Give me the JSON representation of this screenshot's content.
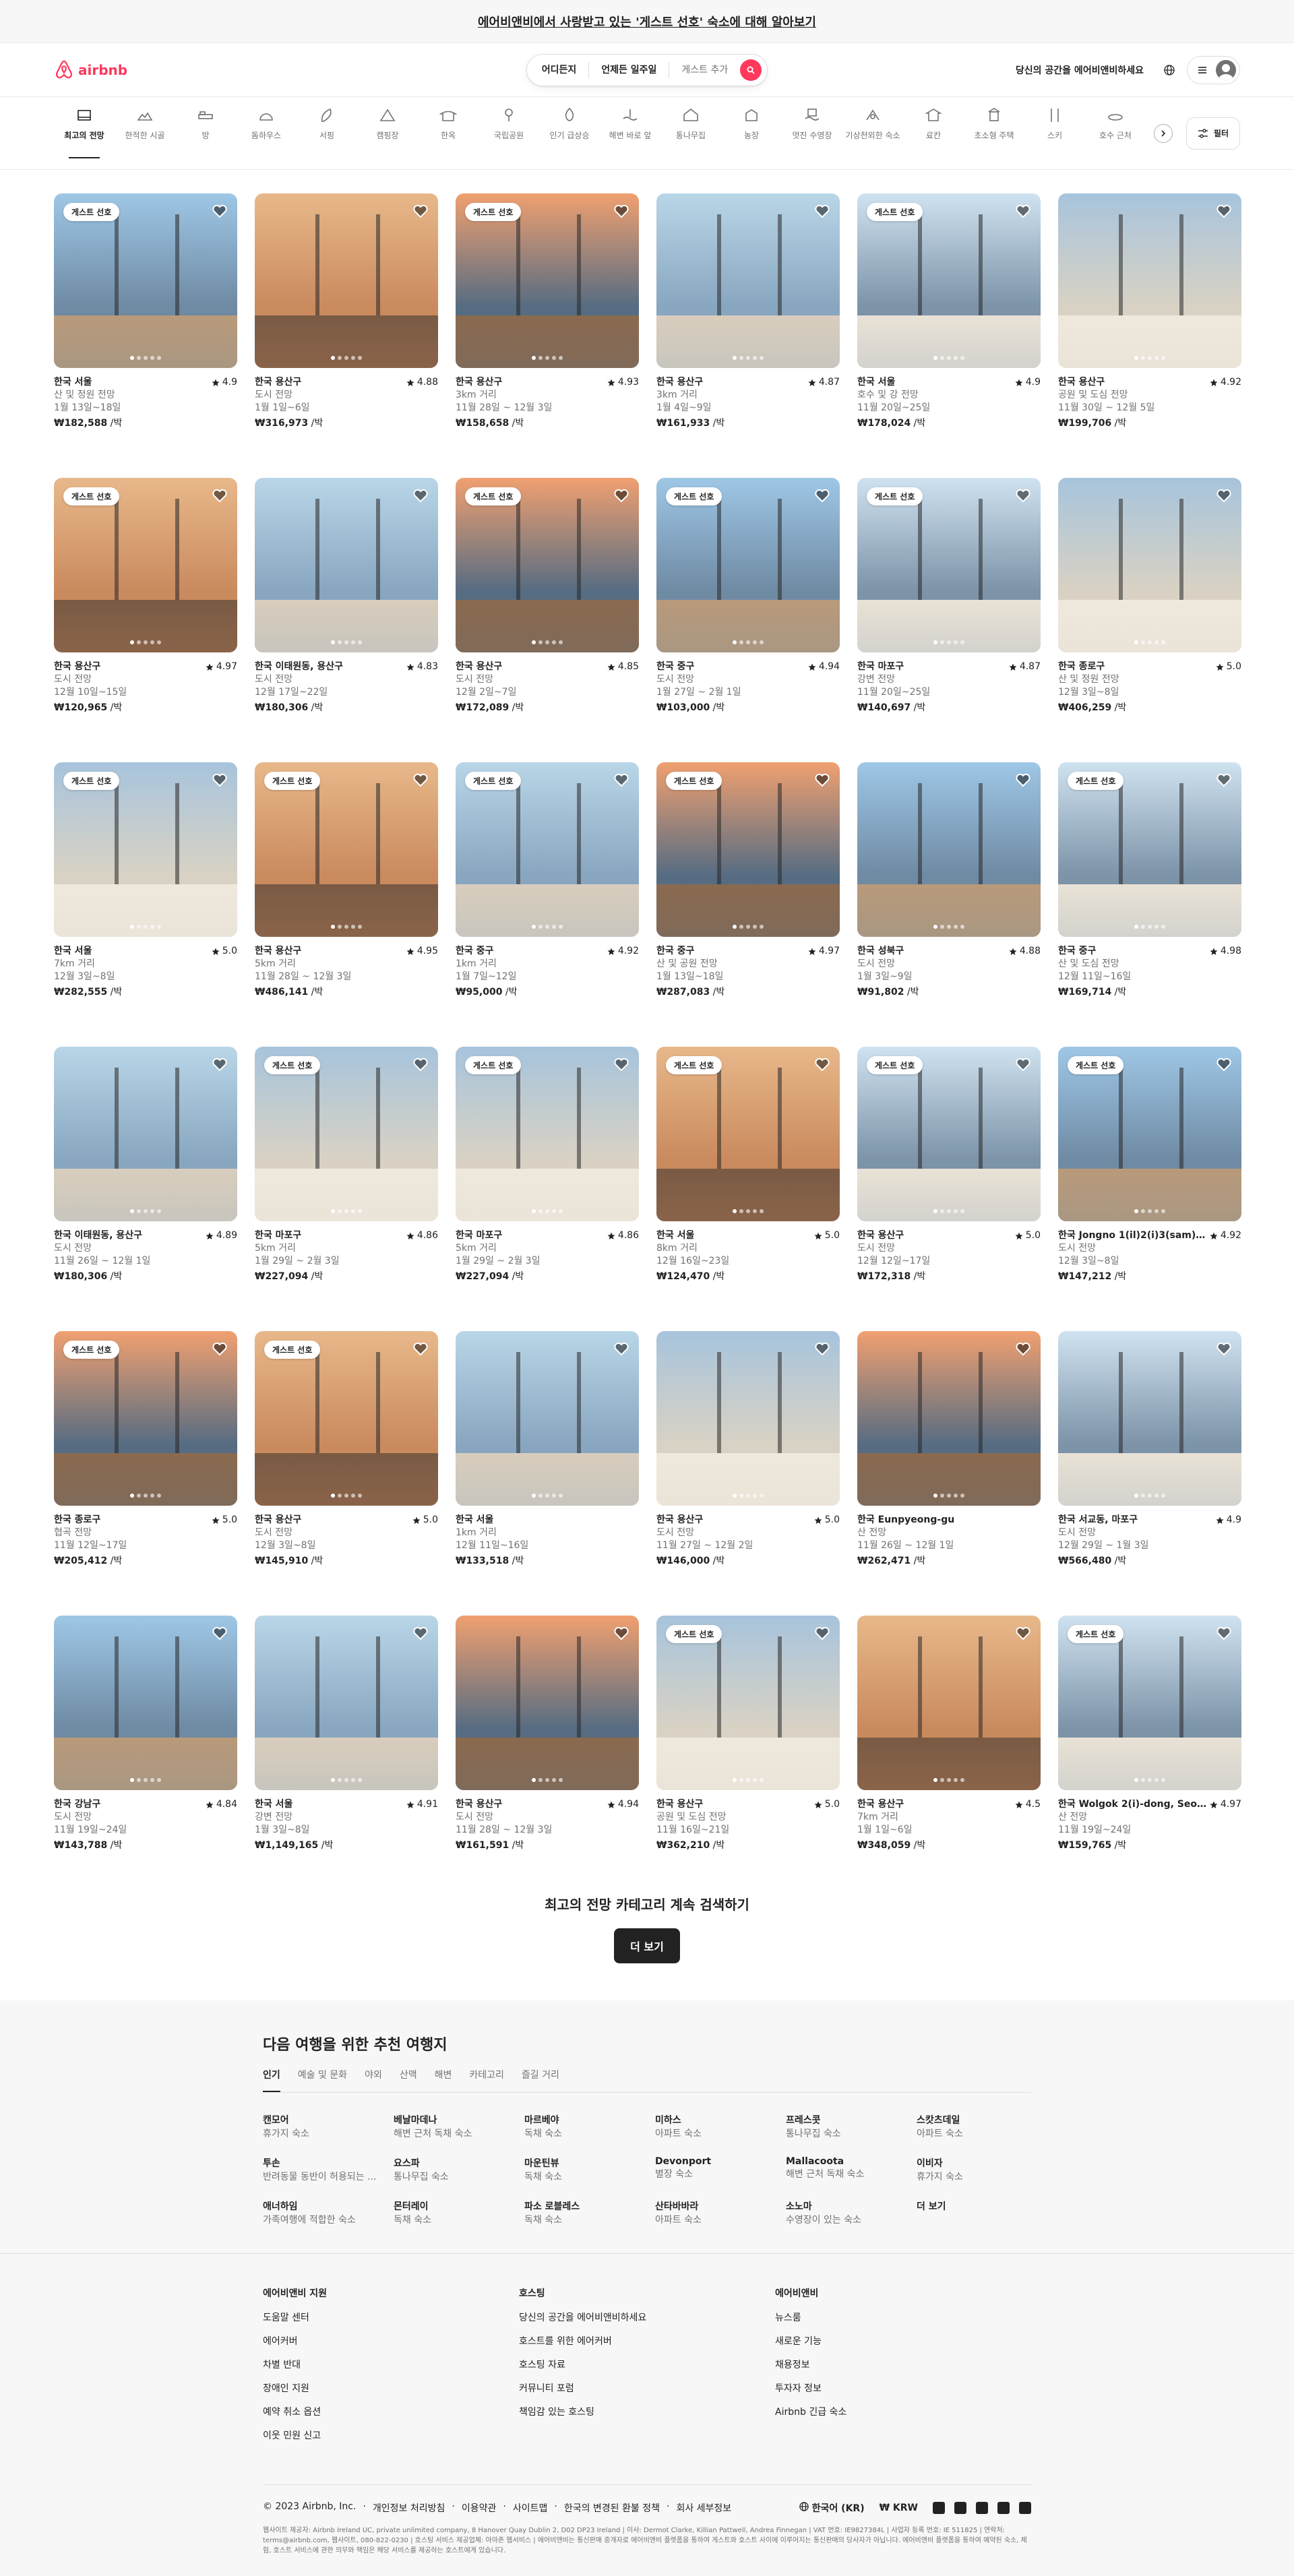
{
  "banner": {
    "text": "에어비앤비에서 사랑받고 있는 '게스트 선호' 숙소에 대해 알아보기"
  },
  "header": {
    "logo": "airbnb",
    "search": {
      "where": "어디든지",
      "when": "언제든 일주일",
      "guests": "게스트 추가"
    },
    "host_link": "당신의 공간을 에어비앤비하세요"
  },
  "categories": [
    {
      "label": "최고의 전망",
      "icon": "view-icon"
    },
    {
      "label": "한적한 시골",
      "icon": "countryside-icon"
    },
    {
      "label": "방",
      "icon": "bed-icon"
    },
    {
      "label": "돔하우스",
      "icon": "dome-icon"
    },
    {
      "label": "서핑",
      "icon": "surf-icon"
    },
    {
      "label": "캠핑장",
      "icon": "camping-icon"
    },
    {
      "label": "한옥",
      "icon": "hanok-icon"
    },
    {
      "label": "국립공원",
      "icon": "park-icon"
    },
    {
      "label": "인기 급상승",
      "icon": "trending-icon"
    },
    {
      "label": "해변 바로 앞",
      "icon": "beach-icon"
    },
    {
      "label": "통나무집",
      "icon": "cabin-icon"
    },
    {
      "label": "농장",
      "icon": "farm-icon"
    },
    {
      "label": "멋진 수영장",
      "icon": "pool-icon"
    },
    {
      "label": "기상천외한 숙소",
      "icon": "omg-icon"
    },
    {
      "label": "료칸",
      "icon": "ryokan-icon"
    },
    {
      "label": "초소형 주택",
      "icon": "tiny-home-icon"
    },
    {
      "label": "스키",
      "icon": "ski-icon"
    },
    {
      "label": "호수 근처",
      "icon": "lake-icon"
    }
  ],
  "filter_label": "필터",
  "badge_label": "게스트 선호",
  "price_suffix": " /박",
  "listings": [
    {
      "loc": "한국 서울",
      "rating": "4.9",
      "line2": "산 및 정원 전망",
      "dates": "1월 13일~18일",
      "price": "₩182,588",
      "badge": true,
      "pal": 0
    },
    {
      "loc": "한국 용산구",
      "rating": "4.88",
      "line2": "도시 전망",
      "dates": "1월 1일~6일",
      "price": "₩316,973",
      "badge": false,
      "pal": 1
    },
    {
      "loc": "한국 용산구",
      "rating": "4.93",
      "line2": "3km 거리",
      "dates": "11월 28일 ~ 12월 3일",
      "price": "₩158,658",
      "badge": true,
      "pal": 2
    },
    {
      "loc": "한국 용산구",
      "rating": "4.87",
      "line2": "3km 거리",
      "dates": "1월 4일~9일",
      "price": "₩161,933",
      "badge": false,
      "pal": 3
    },
    {
      "loc": "한국 서울",
      "rating": "4.9",
      "line2": "호수 및 강 전망",
      "dates": "11월 20일~25일",
      "price": "₩178,024",
      "badge": true,
      "pal": 4
    },
    {
      "loc": "한국 용산구",
      "rating": "4.92",
      "line2": "공원 및 도심 전망",
      "dates": "11월 30일 ~ 12월 5일",
      "price": "₩199,706",
      "badge": false,
      "pal": 5
    },
    {
      "loc": "한국 용산구",
      "rating": "4.97",
      "line2": "도시 전망",
      "dates": "12월 10일~15일",
      "price": "₩120,965",
      "badge": true,
      "pal": 1
    },
    {
      "loc": "한국 이태원동, 용산구",
      "rating": "4.83",
      "line2": "도시 전망",
      "dates": "12월 17일~22일",
      "price": "₩180,306",
      "badge": false,
      "pal": 3
    },
    {
      "loc": "한국 용산구",
      "rating": "4.85",
      "line2": "도시 전망",
      "dates": "12월 2일~7일",
      "price": "₩172,089",
      "badge": true,
      "pal": 2
    },
    {
      "loc": "한국 중구",
      "rating": "4.94",
      "line2": "도시 전망",
      "dates": "1월 27일 ~ 2월 1일",
      "price": "₩103,000",
      "badge": true,
      "pal": 0
    },
    {
      "loc": "한국 마포구",
      "rating": "4.87",
      "line2": "강변 전망",
      "dates": "11월 20일~25일",
      "price": "₩140,697",
      "badge": true,
      "pal": 4
    },
    {
      "loc": "한국 종로구",
      "rating": "5.0",
      "line2": "산 및 정원 전망",
      "dates": "12월 3일~8일",
      "price": "₩406,259",
      "badge": false,
      "pal": 5
    },
    {
      "loc": "한국 서울",
      "rating": "5.0",
      "line2": "7km 거리",
      "dates": "12월 3일~8일",
      "price": "₩282,555",
      "badge": true,
      "pal": 5
    },
    {
      "loc": "한국 용산구",
      "rating": "4.95",
      "line2": "5km 거리",
      "dates": "11월 28일 ~ 12월 3일",
      "price": "₩486,141",
      "badge": true,
      "pal": 1
    },
    {
      "loc": "한국 중구",
      "rating": "4.92",
      "line2": "1km 거리",
      "dates": "1월 7일~12일",
      "price": "₩95,000",
      "badge": true,
      "pal": 3
    },
    {
      "loc": "한국 중구",
      "rating": "4.97",
      "line2": "산 및 공원 전망",
      "dates": "1월 13일~18일",
      "price": "₩287,083",
      "badge": true,
      "pal": 2
    },
    {
      "loc": "한국 성북구",
      "rating": "4.88",
      "line2": "도시 전망",
      "dates": "1월 3일~9일",
      "price": "₩91,802",
      "badge": false,
      "pal": 0
    },
    {
      "loc": "한국 중구",
      "rating": "4.98",
      "line2": "산 및 도심 전망",
      "dates": "12월 11일~16일",
      "price": "₩169,714",
      "badge": true,
      "pal": 4
    },
    {
      "loc": "한국 이태원동, 용산구",
      "rating": "4.89",
      "line2": "도시 전망",
      "dates": "11월 26일 ~ 12월 1일",
      "price": "₩180,306",
      "badge": false,
      "pal": 3
    },
    {
      "loc": "한국 마포구",
      "rating": "4.86",
      "line2": "5km 거리",
      "dates": "1월 29일 ~ 2월 3일",
      "price": "₩227,094",
      "badge": true,
      "pal": 5
    },
    {
      "loc": "한국 마포구",
      "rating": "4.86",
      "line2": "5km 거리",
      "dates": "1월 29일 ~ 2월 3일",
      "price": "₩227,094",
      "badge": true,
      "pal": 5
    },
    {
      "loc": "한국 서울",
      "rating": "5.0",
      "line2": "8km 거리",
      "dates": "12월 16일~23일",
      "price": "₩124,470",
      "badge": true,
      "pal": 1
    },
    {
      "loc": "한국 용산구",
      "rating": "5.0",
      "line2": "도시 전망",
      "dates": "12월 12일~17일",
      "price": "₩172,318",
      "badge": true,
      "pal": 4
    },
    {
      "loc": "한국 Jongno 1(il)2(i)3(sam)4...",
      "rating": "4.92",
      "line2": "도시 전망",
      "dates": "12월 3일~8일",
      "price": "₩147,212",
      "badge": true,
      "pal": 0
    },
    {
      "loc": "한국 종로구",
      "rating": "5.0",
      "line2": "협곡 전망",
      "dates": "11월 12일~17일",
      "price": "₩205,412",
      "badge": true,
      "pal": 2
    },
    {
      "loc": "한국 용산구",
      "rating": "5.0",
      "line2": "도시 전망",
      "dates": "12월 3일~8일",
      "price": "₩145,910",
      "badge": true,
      "pal": 1
    },
    {
      "loc": "한국 서울",
      "rating": "",
      "line2": "1km 거리",
      "dates": "12월 11일~16일",
      "price": "₩133,518",
      "badge": false,
      "pal": 3
    },
    {
      "loc": "한국 용산구",
      "rating": "5.0",
      "line2": "도시 전망",
      "dates": "11월 27일 ~ 12월 2일",
      "price": "₩146,000",
      "badge": false,
      "pal": 5
    },
    {
      "loc": "한국 Eunpyeong-gu",
      "rating": "",
      "line2": "산 전망",
      "dates": "11월 26일 ~ 12월 1일",
      "price": "₩262,471",
      "badge": false,
      "pal": 2
    },
    {
      "loc": "한국 서교동, 마포구",
      "rating": "4.9",
      "line2": "도시 전망",
      "dates": "12월 29일 ~ 1월 3일",
      "price": "₩566,480",
      "badge": false,
      "pal": 4
    },
    {
      "loc": "한국 강남구",
      "rating": "4.84",
      "line2": "도시 전망",
      "dates": "11월 19일~24일",
      "price": "₩143,788",
      "badge": false,
      "pal": 0
    },
    {
      "loc": "한국 서울",
      "rating": "4.91",
      "line2": "강변 전망",
      "dates": "1월 3일~8일",
      "price": "₩1,149,165",
      "badge": false,
      "pal": 3
    },
    {
      "loc": "한국 용산구",
      "rating": "4.94",
      "line2": "도시 전망",
      "dates": "11월 28일 ~ 12월 3일",
      "price": "₩161,591",
      "badge": false,
      "pal": 2
    },
    {
      "loc": "한국 용산구",
      "rating": "5.0",
      "line2": "공원 및 도심 전망",
      "dates": "11월 16일~21일",
      "price": "₩362,210",
      "badge": true,
      "pal": 5
    },
    {
      "loc": "한국 용산구",
      "rating": "4.5",
      "line2": "7km 거리",
      "dates": "1월 1일~6일",
      "price": "₩348,059",
      "badge": false,
      "pal": 1
    },
    {
      "loc": "한국 Wolgok 2(i)-dong, Seong...",
      "rating": "4.97",
      "line2": "산 전망",
      "dates": "11월 19일~24일",
      "price": "₩159,765",
      "badge": true,
      "pal": 4
    }
  ],
  "continue": {
    "title": "최고의 전망 카테고리 계속 검색하기",
    "button": "더 보기"
  },
  "inspiration": {
    "title": "다음 여행을 위한 추천 여행지",
    "tabs": [
      "인기",
      "예술 및 문화",
      "야외",
      "산맥",
      "해변",
      "카테고리",
      "즐길 거리"
    ],
    "destinations": [
      {
        "name": "캔모어",
        "desc": "휴가지 숙소"
      },
      {
        "name": "베날마데나",
        "desc": "해변 근처 독채 숙소"
      },
      {
        "name": "마르베야",
        "desc": "독채 숙소"
      },
      {
        "name": "미하스",
        "desc": "아파트 숙소"
      },
      {
        "name": "프레스콧",
        "desc": "통나무집 숙소"
      },
      {
        "name": "스캇츠데일",
        "desc": "아파트 숙소"
      },
      {
        "name": "투손",
        "desc": "반려동물 동반이 허용되는 ..."
      },
      {
        "name": "요스파",
        "desc": "통나무집 숙소"
      },
      {
        "name": "마운틴뷰",
        "desc": "독채 숙소"
      },
      {
        "name": "Devonport",
        "desc": "별장 숙소"
      },
      {
        "name": "Mallacoota",
        "desc": "해변 근처 독채 숙소"
      },
      {
        "name": "이비자",
        "desc": "휴가지 숙소"
      },
      {
        "name": "애너하임",
        "desc": "가족여행에 적합한 숙소"
      },
      {
        "name": "몬터레이",
        "desc": "독채 숙소"
      },
      {
        "name": "파소 로블레스",
        "desc": "독채 숙소"
      },
      {
        "name": "산타바바라",
        "desc": "아파트 숙소"
      },
      {
        "name": "소노마",
        "desc": "수영장이 있는 숙소"
      },
      {
        "name": "더 보기",
        "desc": ""
      }
    ]
  },
  "footer": {
    "columns": [
      {
        "title": "에어비앤비 지원",
        "links": [
          "도움말 센터",
          "에어커버",
          "차별 반대",
          "장애인 지원",
          "예약 취소 옵션",
          "이웃 민원 신고"
        ]
      },
      {
        "title": "호스팅",
        "links": [
          "당신의 공간을 에어비앤비하세요",
          "호스트를 위한 에어커버",
          "호스팅 자료",
          "커뮤니티 포럼",
          "책임감 있는 호스팅"
        ]
      },
      {
        "title": "에어비앤비",
        "links": [
          "뉴스룸",
          "새로운 기능",
          "채용정보",
          "투자자 정보",
          "Airbnb 긴급 숙소"
        ]
      }
    ],
    "copyright": "© 2023 Airbnb, Inc.",
    "links": [
      "개인정보 처리방침",
      "이용약관",
      "사이트맵",
      "한국의 변경된 환불 정책",
      "회사 세부정보"
    ],
    "language": "한국어 (KR)",
    "currency": "₩ KRW",
    "legal": "웹사이트 제공자: Airbnb Ireland UC, private unlimited company, 8 Hanover Quay Dublin 2, D02 DP23 Ireland | 이사: Dermot Clarke, Killian Pattwell, Andrea Finnegan | VAT 번호: IE9827384L | 사업자 등록 번호: IE 511825 | 연락처: terms@airbnb.com, 웹사이트, 080-822-0230 | 호스팅 서비스 제공업체: 아마존 웹서비스 | 에어비앤비는 통신판매 중개자로 에어비앤비 플랫폼을 통하여 게스트와 호스트 사이에 이루어지는 통신판매의 당사자가 아닙니다. 에어비앤비 플랫폼을 통하여 예약된 숙소, 체험, 호스트 서비스에 관한 의무와 책임은 해당 서비스를 제공하는 호스트에게 있습니다."
  }
}
